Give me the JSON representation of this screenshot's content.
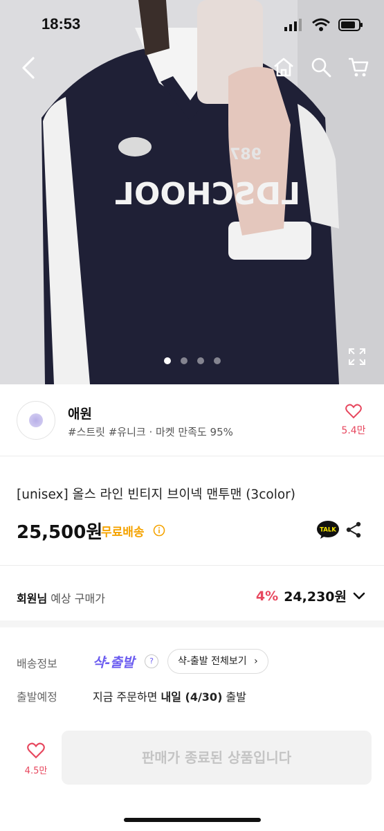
{
  "status": {
    "time": "18:53"
  },
  "hero": {
    "image_count": 4,
    "active_index": 0,
    "shirt_text": "LDSCHOOL",
    "badge_text": "987"
  },
  "seller": {
    "name": "애원",
    "tags": "#스트릿 #유니크 · 마켓 만족도 95%",
    "like_count": "5.4만"
  },
  "product": {
    "title": "[unisex] 올스 라인 빈티지 브이넥 맨투맨 (3color)",
    "price": "25,500원",
    "free_shipping": "무료배송",
    "talk_label": "TALK"
  },
  "member_price": {
    "label_bold": "회원님",
    "label_rest": " 예상 구매가",
    "discount": "4%",
    "amount": "24,230원"
  },
  "shipping": {
    "label": "배송정보",
    "service": "샥-출발",
    "help": "?",
    "view_all": "샥-출발 전체보기",
    "departure_label": "출발예정",
    "departure_prefix": "지금 주문하면 ",
    "departure_bold": "내일 (4/30)",
    "departure_suffix": " 출발"
  },
  "bottom": {
    "like_count": "4.5만",
    "soldout_label": "판매가 종료된 상품입니다"
  },
  "colors": {
    "accent_red": "#e7475e",
    "free_ship": "#f5a300",
    "sak_purple": "#6b5cf0"
  }
}
